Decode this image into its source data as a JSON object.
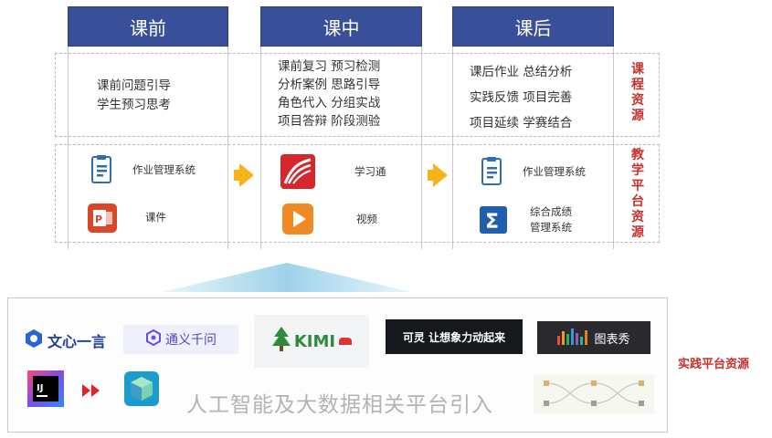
{
  "stages": [
    {
      "title": "课前"
    },
    {
      "title": "课中"
    },
    {
      "title": "课后"
    }
  ],
  "course_resources": {
    "label": "课程资源",
    "pre": [
      "课前问题引导",
      "学生预习思考"
    ],
    "in": [
      "课前复习 预习检测",
      "分析案例 思路引导",
      "角色代入 分组实战",
      "项目答辩 阶段测验"
    ],
    "post": [
      "课后作业 总结分析",
      "实践反馈 项目完善",
      "项目延续 学赛结合"
    ]
  },
  "platform_resources": {
    "label": "教学平台资源",
    "pre": [
      {
        "icon": "document-icon",
        "label": "作业管理系统"
      },
      {
        "icon": "powerpoint-icon",
        "label": "课件"
      }
    ],
    "in": [
      {
        "icon": "xuexitong-icon",
        "label": "学习通"
      },
      {
        "icon": "video-play-icon",
        "label": "视频"
      }
    ],
    "post": [
      {
        "icon": "document-icon",
        "label": "作业管理系统"
      },
      {
        "icon": "sigma-icon",
        "label": "综合成绩\n管理系统"
      }
    ]
  },
  "practice_platform": {
    "label": "实践平台资源",
    "logos": {
      "wenxin": "文心一言",
      "tongyi": "通义千问",
      "kimi": "KIMI",
      "keling": "可灵 让想象力动起来",
      "tubiaoxiu": "图表秀",
      "intellij": "IJ"
    },
    "caption": "人工智能及大数据相关平台引入"
  },
  "colors": {
    "header_bg": "#3a4f99",
    "accent_red": "#c9302c",
    "arrow_yellow": "#f5b519",
    "up_arrow_blue": "#9fd2ea"
  }
}
